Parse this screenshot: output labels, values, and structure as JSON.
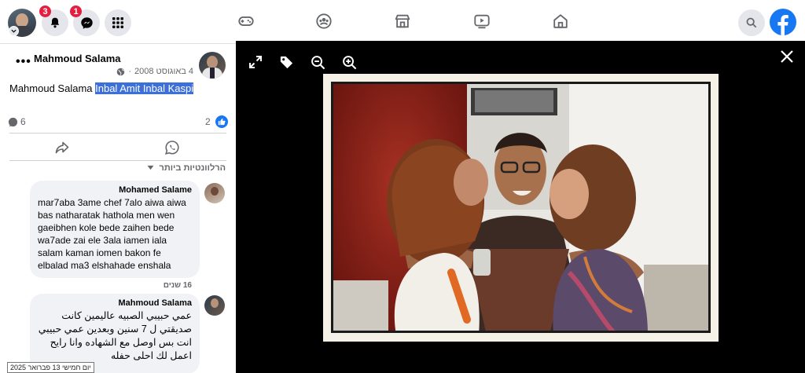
{
  "topbar": {
    "notifications_count": "3",
    "messenger_count": "1",
    "icons": {
      "profile": "profile-avatar",
      "notifications": "bell-icon",
      "messenger": "messenger-icon",
      "menu": "grid-menu-icon",
      "gaming": "gaming-icon",
      "groups": "groups-icon",
      "marketplace": "marketplace-icon",
      "watch": "video-icon",
      "home": "home-icon",
      "search": "search-icon",
      "logo": "facebook-logo"
    },
    "brand_color": "#1877f2",
    "badge_color": "#e41e3f"
  },
  "post": {
    "author": "Mahmoud Salama",
    "date": "4 באוגוסט 2008",
    "separator": "·",
    "caption_plain": "Mahmoud Salama ",
    "caption_tagged": "Inbal Amit Inbal Kaspi",
    "comments_count": "6",
    "likes_count": "2",
    "relevant_label": "הרלוונטיות ביותר"
  },
  "comments": [
    {
      "name": "Mohamed Salame",
      "text": "mar7aba 3ame chef 7alo aiwa aiwa bas natharatak hathola men wen gaeibhen kole bede zaihen bede wa7ade zai ele 3ala iamen iala salam kaman iomen bakon fe elbalad ma3 elshahade enshala",
      "time": "16 שנים"
    },
    {
      "name": "Mahmoud Salama",
      "text": "عمي حبيبي الصبيه عاليمين كانت صديقتي ل 7 سنين وبعدين عمي حبيبي انت بس اوصل مع الشهاده وانا رايح اعمل لك احلى حفله"
    }
  ],
  "tooltip": "יום חמישי 13 פברואר 2025"
}
